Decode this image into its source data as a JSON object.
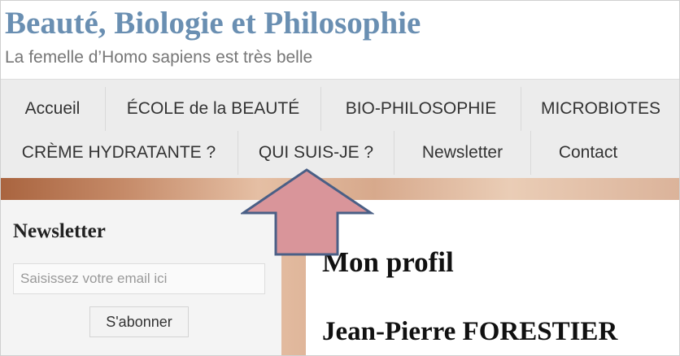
{
  "site": {
    "title": "Beauté, Biologie et Philosophie",
    "tagline": "La femelle d’Homo sapiens est très belle"
  },
  "nav": {
    "row1": [
      {
        "label": "Accueil"
      },
      {
        "label": "ÉCOLE de la BEAUTÉ"
      },
      {
        "label": "BIO-PHILOSOPHIE"
      },
      {
        "label": "MICROBIOTES"
      }
    ],
    "row2": [
      {
        "label": "CRÈME HYDRATANTE ?"
      },
      {
        "label": "QUI SUIS-JE ?"
      },
      {
        "label": "Newsletter"
      },
      {
        "label": "Contact"
      }
    ]
  },
  "sidebar": {
    "widget_title": "Newsletter",
    "email_placeholder": "Saisissez votre email ici",
    "email_value": "",
    "subscribe_label": "S'abonner"
  },
  "content": {
    "page_title": "Mon profil",
    "name": "Jean-Pierre FORESTIER"
  },
  "colors": {
    "title": "#6a8fb2",
    "arrow_fill": "#d9959a",
    "arrow_stroke": "#4a5f86",
    "nav_bg": "#ececec"
  },
  "icons": {
    "annotation": "up-arrow-icon"
  }
}
